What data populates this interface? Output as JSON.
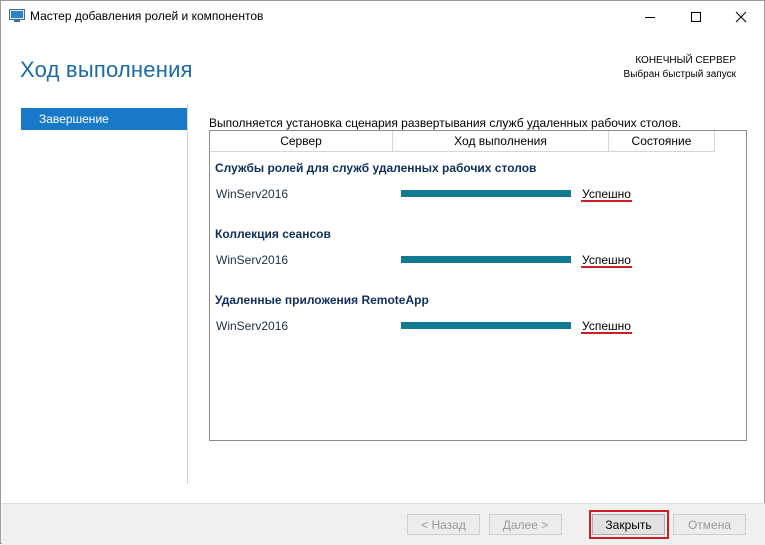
{
  "window": {
    "title": "Мастер добавления ролей и компонентов",
    "icon": "server-manager-icon",
    "controls": [
      "minimize-icon",
      "maximize-icon",
      "close-icon"
    ]
  },
  "header": {
    "title": "Ход выполнения",
    "destination_label": "КОНЕЧНЫЙ СЕРВЕР",
    "destination_value": "Выбран быстрый запуск"
  },
  "nav": {
    "items": [
      {
        "label": "Завершение",
        "selected": true
      }
    ]
  },
  "main": {
    "intro": "Выполняется установка сценария развертывания служб удаленных рабочих столов.",
    "columns": [
      "Сервер",
      "Ход выполнения",
      "Состояние"
    ],
    "groups": [
      {
        "title": "Службы ролей для служб удаленных рабочих столов",
        "server": "WinServ2016",
        "progress": 100,
        "status": "Успешно"
      },
      {
        "title": "Коллекция сеансов",
        "server": "WinServ2016",
        "progress": 100,
        "status": "Успешно"
      },
      {
        "title": "Удаленные приложения RemoteApp",
        "server": "WinServ2016",
        "progress": 100,
        "status": "Успешно"
      }
    ]
  },
  "footer": {
    "back": "< Назад",
    "next": "Далее >",
    "close": "Закрыть",
    "cancel": "Отмена"
  },
  "colors": {
    "accent": "#1979c9",
    "title_blue": "#1a6aa6",
    "progress": "#137a94",
    "highlight_red": "#cc1f24"
  }
}
